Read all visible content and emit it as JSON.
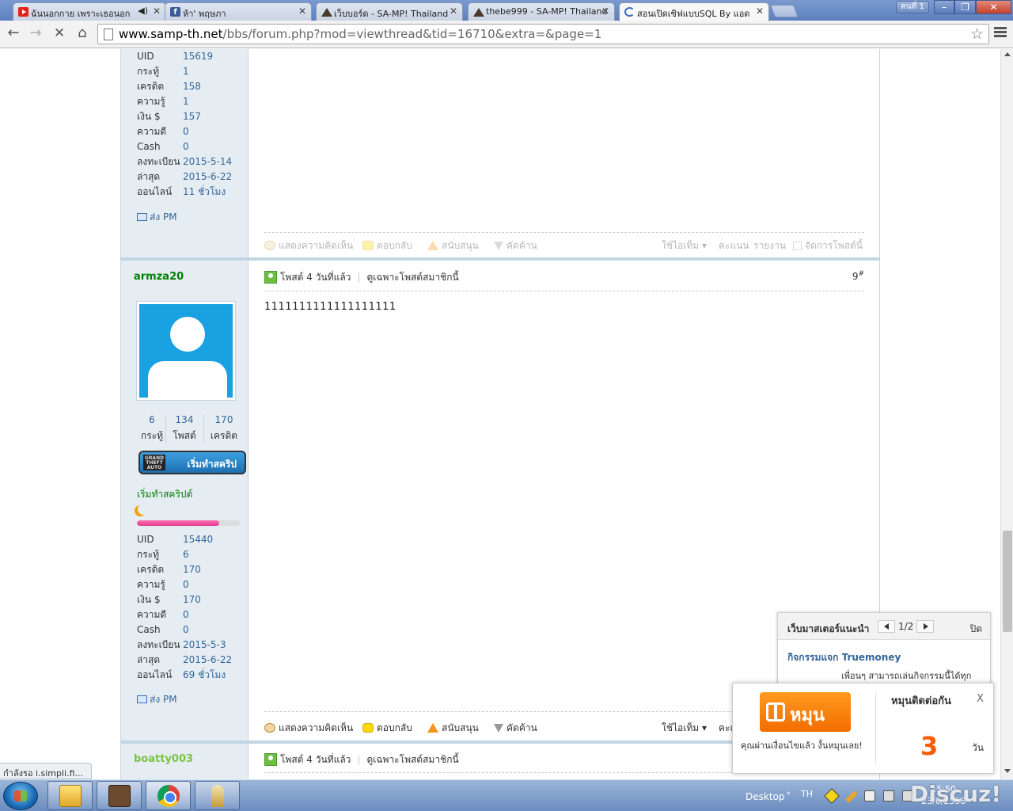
{
  "browser": {
    "tabs": [
      {
        "title": "ฉันนอกกาย เพราะเธอนอก",
        "favicon": "youtube-icon",
        "audio": true
      },
      {
        "title": "ห้า' พฤษภา",
        "favicon": "facebook-icon"
      },
      {
        "title": "เว็บบอร์ด - SA-MP! Thailand",
        "favicon": "samp-icon"
      },
      {
        "title": "thebe999 - SA-MP! Thailand",
        "favicon": "samp-icon"
      },
      {
        "title": "สอนเปิดเซิฟแบบSQL By แอด",
        "favicon": "loading-icon",
        "active": true
      }
    ],
    "profile_label": "คนที่ 1",
    "url_host": "www.samp-th.net",
    "url_path": "/bbs/forum.php?mod=viewthread&tid=16710&extra=&page=1",
    "status_text": "กำลังรอ i.simpli.fi..."
  },
  "post_prev": {
    "stats": [
      {
        "label": "UID",
        "value": "15619"
      },
      {
        "label": "กระทู้",
        "value": "1"
      },
      {
        "label": "เครดิต",
        "value": "158"
      },
      {
        "label": "ความรู้",
        "value": "1"
      },
      {
        "label": "เงิน $",
        "value": "157"
      },
      {
        "label": "ความดี",
        "value": "0"
      },
      {
        "label": "Cash",
        "value": "0"
      },
      {
        "label": "ลงทะเบียน",
        "value": "2015-5-14"
      },
      {
        "label": "ล่าสุด",
        "value": "2015-6-22"
      },
      {
        "label": "ออนไลน์",
        "value": "11 ชั่วโมง"
      }
    ],
    "pm_label": "ส่ง PM"
  },
  "actions": {
    "comment": "แสดงความคิดเห็น",
    "reply": "ตอบกลับ",
    "support": "สนับสนุน",
    "oppose": "คัดค้าน",
    "use_item": "ใช้ไอเท็ม",
    "rate": "คะแนน",
    "report": "รายงาน",
    "manage": "จัดการโพสต์นี้"
  },
  "post_main": {
    "username": "armza20",
    "mini_stats": [
      {
        "num": "6",
        "cap": "กระทู้"
      },
      {
        "num": "134",
        "cap": "โพสต์"
      },
      {
        "num": "170",
        "cap": "เครดิต"
      }
    ],
    "rank_badge": "เริ่มทำสคริป",
    "rank_name": "เริ่มทำสคริปต์",
    "rank_progress": 0.8,
    "stats": [
      {
        "label": "UID",
        "value": "15440"
      },
      {
        "label": "กระทู้",
        "value": "6"
      },
      {
        "label": "เครดิต",
        "value": "170"
      },
      {
        "label": "ความรู้",
        "value": "0"
      },
      {
        "label": "เงิน $",
        "value": "170"
      },
      {
        "label": "ความดี",
        "value": "0"
      },
      {
        "label": "Cash",
        "value": "0"
      },
      {
        "label": "ลงทะเบียน",
        "value": "2015-5-3"
      },
      {
        "label": "ล่าสุด",
        "value": "2015-6-22"
      },
      {
        "label": "ออนไลน์",
        "value": "69 ชั่วโมง"
      }
    ],
    "pm_label": "ส่ง PM",
    "posted": "โพสต์ 4 วันที่แล้ว",
    "only_author": "ดูเฉพาะโพสต์สมาชิกนี้",
    "floor": "9",
    "floor_mark": "#",
    "body": "1111111111111111111"
  },
  "post_next": {
    "username": "boatty003",
    "posted": "โพสต์ 4 วันที่แล้ว",
    "only_author": "ดูเฉพาะโพสต์สมาชิกนี้"
  },
  "recommend": {
    "title": "เว็บมาสเตอร์แนะนำ",
    "page": "1/2",
    "close": "ปิด",
    "item_title": "กิจกรรมแจก Truemoney",
    "item_desc": "เพื่อนๆ สามารถเล่นกิจกรรมนี้ได้ทุก"
  },
  "spin": {
    "button": "หมุนเลย",
    "note": "คุณผ่านเงื่อนไขแล้ว งั้นหมุนเลย!",
    "title": "หมุนติดต่อกัน",
    "close": "X",
    "days": "3",
    "unit": "วัน"
  },
  "taskbar": {
    "desktop": "Desktop",
    "lang": "TH",
    "time": "15:50",
    "date": "23/6/2558",
    "watermark": "Discuz!"
  }
}
